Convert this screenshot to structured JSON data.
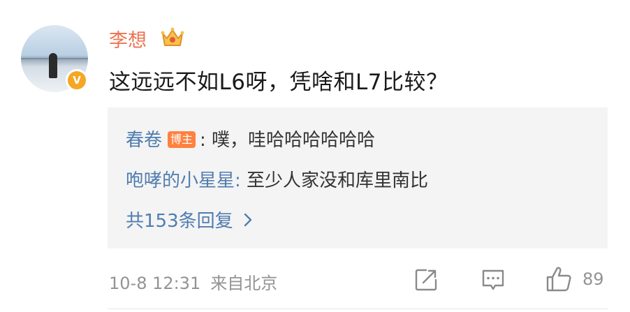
{
  "comment": {
    "username": "李想",
    "verified_badge": "V",
    "text": "这远远不如L6呀，凭啥和L7比较？",
    "icons": {
      "crown": "crown-icon",
      "verified": "verified-badge-icon"
    }
  },
  "replies": [
    {
      "name": "春卷",
      "tag": "博主",
      "separator": ":",
      "text": " 噗，哇哈哈哈哈哈哈"
    },
    {
      "name": "咆哮的小星星",
      "tag": "",
      "separator": ":",
      "text": " 至少人家没和库里南比"
    }
  ],
  "more_replies": {
    "label": "共153条回复",
    "icon": "chevron-right-icon"
  },
  "footer": {
    "time": "10-8 12:31",
    "location": "来自北京",
    "like_count": "89",
    "icons": [
      "share-icon",
      "comment-icon",
      "like-icon"
    ]
  },
  "colors": {
    "username": "#eb7350",
    "link": "#507daf",
    "meta": "#939393",
    "reply_bg": "#f4f4f4",
    "host_tag": "#ff8140"
  }
}
